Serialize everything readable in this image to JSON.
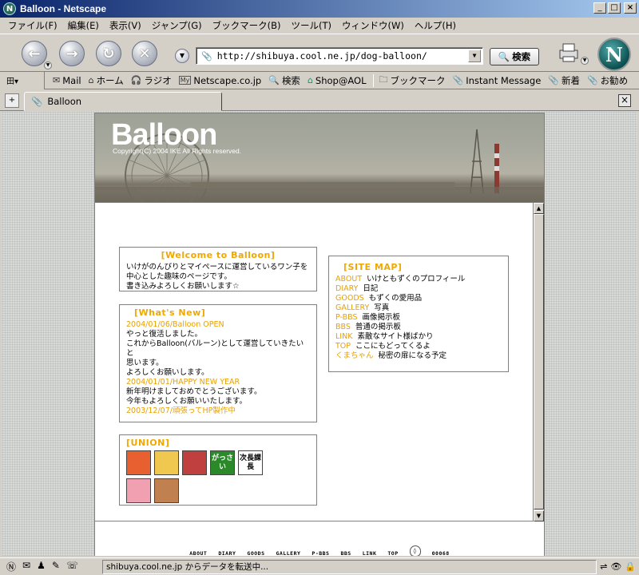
{
  "window": {
    "title": "Balloon - Netscape",
    "app_icon": "N"
  },
  "menu": [
    "ファイル(F)",
    "編集(E)",
    "表示(V)",
    "ジャンプ(G)",
    "ブックマーク(B)",
    "ツール(T)",
    "ウィンドウ(W)",
    "ヘルプ(H)"
  ],
  "nav": {
    "url": "http://shibuya.cool.ne.jp/dog-balloon/",
    "search_label": "検索",
    "logo": "N"
  },
  "personal_toolbar": {
    "items": [
      "Mail",
      "ホーム",
      "ラジオ",
      "Netscape.co.jp",
      "検索",
      "Shop@AOL",
      "ブックマーク",
      "Instant Message",
      "新着",
      "お勧め"
    ],
    "icons": [
      "mail-icon",
      "home-icon",
      "radio-icon",
      "my-netscape-icon",
      "search-icon",
      "shop-icon",
      "bookmark-folder-icon",
      "link-icon",
      "link-icon",
      "link-icon"
    ]
  },
  "tab": {
    "label": "Balloon"
  },
  "site": {
    "logo": "Balloon",
    "copyright": "Copyright(C) 2004 IKE All Rights reserved.",
    "welcome": {
      "heading": "[Welcome to Balloon]",
      "lines": [
        "いけがのんびりとマイペースに運営しているワン子を",
        "中心とした趣味のページです。",
        "書き込みよろしくお願いします☆"
      ]
    },
    "whats_new": {
      "heading": "[What's New]",
      "entries": [
        {
          "date": "2004/01/06/Balloon OPEN",
          "lines": [
            "やっと復活しました。",
            "これからBalloon(バルーン)として運営していきたいと",
            "思います。",
            "よろしくお願いします。"
          ]
        },
        {
          "date": "2004/01/01/HAPPY NEW YEAR",
          "lines": [
            "新年明けましておめでとうございます。",
            "今年もよろしくお願いいたします。"
          ]
        },
        {
          "date": "2003/12/07/頑張ってHP製作中",
          "lines": []
        }
      ]
    },
    "sitemap": {
      "heading": "[SITE MAP]",
      "items": [
        {
          "link": "ABOUT",
          "desc": "いけともずくのプロフィール"
        },
        {
          "link": "DIARY",
          "desc": "日記"
        },
        {
          "link": "GOODS",
          "desc": "もずくの愛用品"
        },
        {
          "link": "GALLERY",
          "desc": "写真"
        },
        {
          "link": "P-BBS",
          "desc": "画像掲示板"
        },
        {
          "link": "BBS",
          "desc": "普通の掲示板"
        },
        {
          "link": "LINK",
          "desc": "素敵なサイト様ばかり"
        },
        {
          "link": "TOP",
          "desc": "ここにもどってくるよ"
        },
        {
          "link": "くまちゃん",
          "desc": "秘密の扉になる予定"
        }
      ]
    },
    "union": {
      "heading": "[UNION]",
      "icons": [
        {
          "name": "union-icon-1",
          "text": "",
          "bg": "#e86030"
        },
        {
          "name": "union-icon-2",
          "text": "",
          "bg": "#f0c850"
        },
        {
          "name": "union-icon-3",
          "text": "",
          "bg": "#c04040"
        },
        {
          "name": "union-icon-4",
          "text": "がっさい",
          "bg": "#2a8a2a"
        },
        {
          "name": "union-icon-5",
          "text": "次長課長",
          "bg": "#ffffff"
        },
        {
          "name": "union-icon-6",
          "text": "",
          "bg": "#f0a0b0"
        },
        {
          "name": "union-icon-7",
          "text": "",
          "bg": "#c08050"
        }
      ]
    },
    "footer_nav": [
      "ABOUT",
      "DIARY",
      "GOODS",
      "GALLERY",
      "P-BBS",
      "BBS",
      "LINK",
      "TOP"
    ],
    "counter": "00068"
  },
  "status": {
    "text": "shibuya.cool.ne.jp からデータを転送中..."
  },
  "colors": {
    "accent": "#f0a800",
    "title_bar": "#0a246a"
  }
}
